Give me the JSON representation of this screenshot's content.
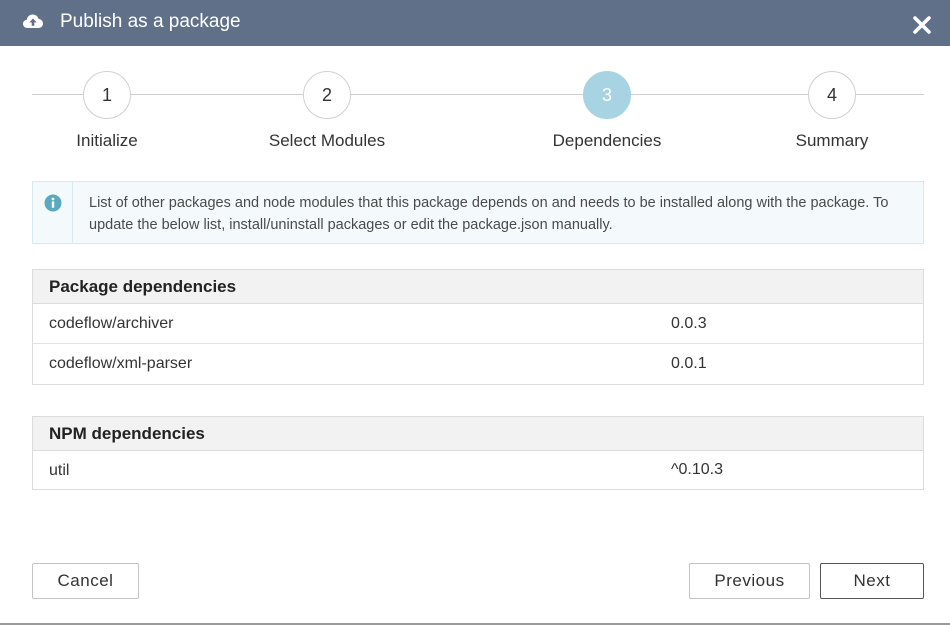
{
  "dialog": {
    "title": "Publish as a package",
    "icons": {
      "title_icon": "cloud-upload-icon",
      "close": "close-icon"
    }
  },
  "stepper": {
    "steps": [
      {
        "number": "1",
        "label": "Initialize"
      },
      {
        "number": "2",
        "label": "Select Modules"
      },
      {
        "number": "3",
        "label": "Dependencies"
      },
      {
        "number": "4",
        "label": "Summary"
      }
    ],
    "active_step": 3
  },
  "info": {
    "icon": "info-icon",
    "text": "List of other packages and node modules that this package depends on and needs to be installed along with the package. To update the below list, install/uninstall packages or edit the package.json manually."
  },
  "package_dependencies": {
    "heading": "Package dependencies",
    "rows": [
      {
        "name": "codeflow/archiver",
        "version": "0.0.3"
      },
      {
        "name": "codeflow/xml-parser",
        "version": "0.0.1"
      }
    ]
  },
  "npm_dependencies": {
    "heading": "NPM dependencies",
    "rows": [
      {
        "name": "util",
        "version": "^0.10.3"
      }
    ]
  },
  "buttons": {
    "cancel": "Cancel",
    "previous": "Previous",
    "next": "Next"
  },
  "colors": {
    "titlebar": "#607089",
    "active_step": "#a7d3e2",
    "info_background": "#f4fafc",
    "info_icon": "#5aa9bf"
  }
}
